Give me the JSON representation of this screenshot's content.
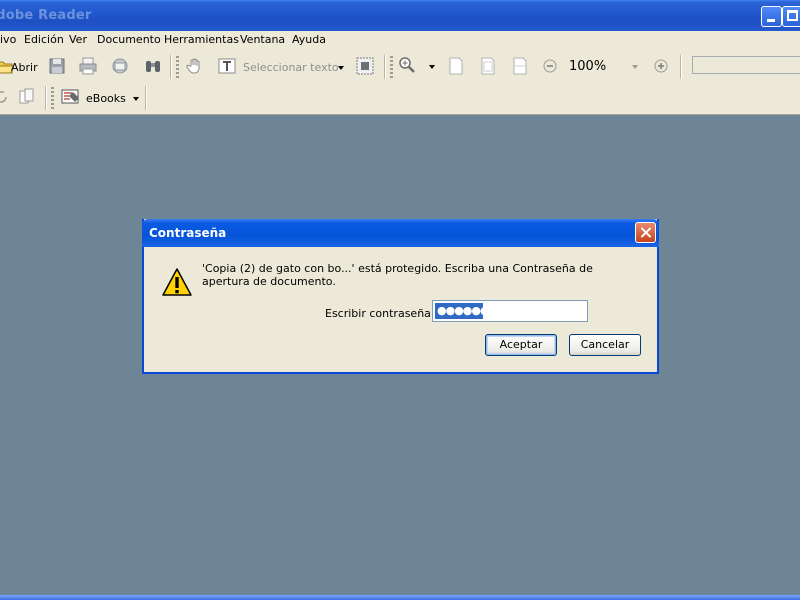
{
  "window": {
    "title": "Adobe Reader"
  },
  "menu": [
    "ivo",
    "Edición",
    "Ver",
    "Documento",
    "Herramientas",
    "Ventana",
    "Ayuda"
  ],
  "toolbar": {
    "open_label": "Abrir",
    "select_text_label": "Seleccionar texto",
    "zoom": "100%",
    "ebooks_label": "eBooks"
  },
  "dialog": {
    "title": "Contraseña",
    "message": "'Copia (2) de gato con bo...' está protegido.  Escriba una Contraseña de apertura de documento.",
    "password_label": "Escribir contraseña:",
    "password_value": "●●●●●●",
    "ok_label": "Aceptar",
    "cancel_label": "Cancelar"
  },
  "colors": {
    "workspace": "#6e8596",
    "titlebar": "#1f56cc",
    "dialog_frame": "#0a49d6",
    "selection": "#316ac5"
  }
}
